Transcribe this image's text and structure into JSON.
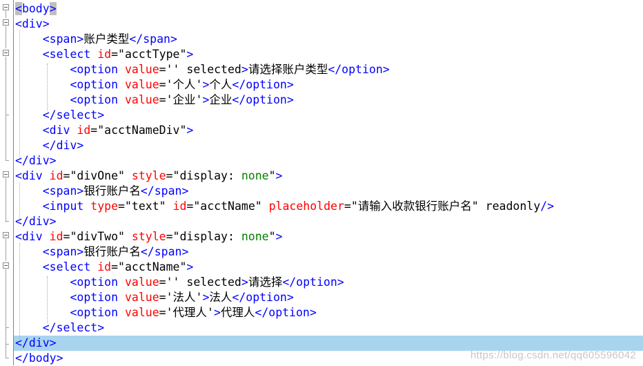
{
  "code": {
    "l1": {
      "t1": "<",
      "t2": "body",
      "t3": ">"
    },
    "l2": {
      "tag": "<div>"
    },
    "l3": {
      "open": "<span>",
      "text": "账户类型",
      "close": "</span>"
    },
    "l4": {
      "open": "<select ",
      "attr": "id",
      "eq": "=",
      "val": "\"acctType\"",
      "end": ">"
    },
    "l5": {
      "open": "<option ",
      "attr": "value",
      "eq": "=",
      "val": "''",
      "sp": " ",
      "sel": "selected",
      "gt": ">",
      "text": "请选择账户类型",
      "close": "</option>"
    },
    "l6": {
      "open": "<option ",
      "attr": "value",
      "eq": "=",
      "val": "'个人'",
      "gt": ">",
      "text": "个人",
      "close": "</option>"
    },
    "l7": {
      "open": "<option ",
      "attr": "value",
      "eq": "=",
      "val": "'企业'",
      "gt": ">",
      "text": "企业",
      "close": "</option>"
    },
    "l8": {
      "tag": "</select>"
    },
    "l9": {
      "open": "<div ",
      "attr": "id",
      "eq": "=",
      "val": "\"acctNameDiv\"",
      "end": ">"
    },
    "l10": {
      "tag": "</div>"
    },
    "l11": {
      "tag": "</div>"
    },
    "l12": {
      "open": "<div ",
      "attr1": "id",
      "eq1": "=",
      "val1": "\"divOne\"",
      "sp": " ",
      "attr2": "style",
      "eq2": "=",
      "q1": "\"display: ",
      "v2": "none",
      "q2": "\"",
      "end": ">"
    },
    "l13": {
      "open": "<span>",
      "text": "银行账户名",
      "close": "</span>"
    },
    "l14": {
      "open": "<input ",
      "attr1": "type",
      "eq1": "=",
      "val1": "\"text\"",
      "sp1": " ",
      "attr2": "id",
      "eq2": "=",
      "val2": "\"acctName\"",
      "sp2": " ",
      "attr3": "placeholder",
      "eq3": "=",
      "val3": "\"请输入收款银行账户名\"",
      "sp3": " ",
      "ro": "readonly",
      "end": "/>"
    },
    "l15": {
      "tag": "</div>"
    },
    "l16": {
      "open": "<div ",
      "attr1": "id",
      "eq1": "=",
      "val1": "\"divTwo\"",
      "sp": " ",
      "attr2": "style",
      "eq2": "=",
      "q1": "\"display: ",
      "v2": "none",
      "q2": "\"",
      "end": ">"
    },
    "l17": {
      "open": "<span>",
      "text": "银行账户名",
      "close": "</span>"
    },
    "l18": {
      "open": "<select ",
      "attr": "id",
      "eq": "=",
      "val": "\"acctName\"",
      "end": ">"
    },
    "l19": {
      "open": "<option ",
      "attr": "value",
      "eq": "=",
      "val": "''",
      "sp": " ",
      "sel": "selected",
      "gt": ">",
      "text": "请选择",
      "close": "</option>"
    },
    "l20": {
      "open": "<option ",
      "attr": "value",
      "eq": "=",
      "val": "'法人'",
      "gt": ">",
      "text": "法人",
      "close": "</option>"
    },
    "l21": {
      "open": "<option ",
      "attr": "value",
      "eq": "=",
      "val": "'代理人'",
      "gt": ">",
      "text": "代理人",
      "close": "</option>"
    },
    "l22": {
      "tag": "</select>"
    },
    "l23": {
      "tag": "</div>"
    },
    "l24": {
      "tag": "</body>"
    }
  },
  "watermark": "https://blog.csdn.net/qq605596042",
  "colors": {
    "tag": "#0000ff",
    "attribute": "#ff0000",
    "value": "#8000ff",
    "green_value": "#008000",
    "highlight": "#a8d4ee",
    "gutter_line": "#3cb043"
  }
}
